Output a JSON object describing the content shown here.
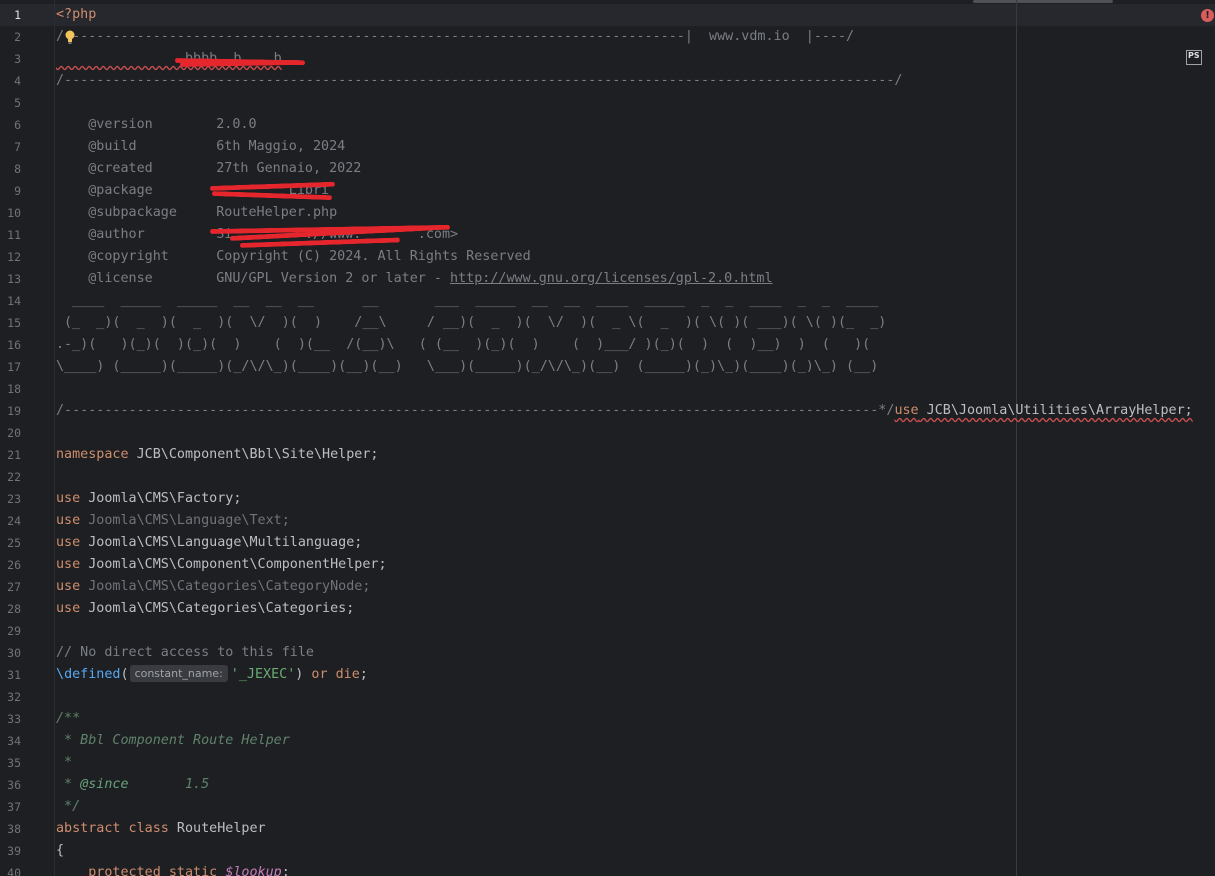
{
  "gutter": {
    "line_numbers": [
      "1",
      "2",
      "3",
      "4",
      "5",
      "6",
      "7",
      "8",
      "9",
      "10",
      "11",
      "12",
      "13",
      "14",
      "15",
      "16",
      "17",
      "18",
      "19",
      "20",
      "21",
      "22",
      "23",
      "24",
      "25",
      "26",
      "27",
      "28",
      "29",
      "30",
      "31",
      "32",
      "33",
      "34",
      "35",
      "36",
      "37",
      "38",
      "39",
      "40"
    ]
  },
  "header": {
    "open_tag": "<?php",
    "banner_top": "/-----------------------------------------------------------------------------|  www.vdm.io  |----/",
    "author_redacted": "                bbbb  b    b",
    "banner_sep": "/-------------------------------------------------------------------------------------------------------/",
    "version_key": "@version",
    "version_val": "2.0.0",
    "build_key": "@build",
    "build_val": "6th Maggio, 2024",
    "created_key": "@created",
    "created_val": "27th Gennaio, 2022",
    "package_key": "@package",
    "package_val": "         Libri",
    "subpackage_key": "@subpackage",
    "subpackage_val": "RouteHelper.php",
    "author_key": "@author",
    "author_val": "Si         ://www.       .com>",
    "copyright_key": "@copyright",
    "copyright_val": "Copyright (C) 2024. All Rights Reserved",
    "license_key": "@license",
    "license_prefix": "GNU/GPL Version 2 or later - ",
    "license_url": "http://www.gnu.org/licenses/gpl-2.0.html",
    "ascii_1": "  ____  _____  _____  __  __  __      __       ___  _____  __  __  ____  _____  _  _  ____  _  _  ____",
    "ascii_2": " (_  _)(  _  )(  _  )(  \\/  )(  )    /__\\     / __)(  _  )(  \\/  )(  _ \\(  _  )( \\( )( ___)( \\( )(_  _)",
    "ascii_3": ".-_)(   )(_)(  )(_)(  )    (  )(__  /(__)\\   ( (__  )(_)(  )    (  )___/ )(_)(  )  (  )__)  )  (   )(",
    "ascii_4": "\\____) (_____)(_____)(_/\\/\\_)(____)(__)(__)   \\___)(_____)(_/\\/\\_)(__)  (_____)(_)\\_)(____)(_)\\_) (__)",
    "banner_end": "/-----------------------------------------------------------------------------------------------------*/",
    "banner_use_kw": "use",
    "banner_use_ns": " JCB\\Joomla\\Utilities\\ArrayHelper;"
  },
  "code": {
    "namespace_kw": "namespace",
    "namespace_val": " JCB\\Component\\Bbl\\Site\\Helper;",
    "use_kw": "use",
    "uses": [
      {
        "ns": " Joomla\\CMS\\Factory;",
        "unused": false
      },
      {
        "ns": " Joomla\\CMS\\Language\\Text;",
        "unused": true
      },
      {
        "ns": " Joomla\\CMS\\Language\\Multilanguage;",
        "unused": false
      },
      {
        "ns": " Joomla\\CMS\\Component\\ComponentHelper;",
        "unused": false
      },
      {
        "ns": " Joomla\\CMS\\Categories\\CategoryNode;",
        "unused": true
      },
      {
        "ns": " Joomla\\CMS\\Categories\\Categories;",
        "unused": false
      }
    ],
    "comment_access": "// No direct access to this file",
    "defined_slash": "\\",
    "defined_fn": "defined",
    "defined_open": "(",
    "param_hint": "constant_name:",
    "defined_arg": "'_JEXEC'",
    "defined_close": ")",
    "or_kw": "or",
    "die_kw": "die",
    "semicolon": ";",
    "doc_open": "/**",
    "doc_title": " * Bbl Component Route Helper",
    "doc_blank": " *",
    "doc_since_star": " * ",
    "doc_since_tag": "@since",
    "doc_since_val": "       1.5",
    "doc_close": " */",
    "abstract_kw": "abstract",
    "class_kw": " class",
    "class_name": " RouteHelper",
    "brace_open": "{",
    "prop_kw": "    protected static",
    "prop_var": "$lookup",
    "prop_end": ";"
  },
  "status": {
    "error_glyph": "!",
    "file_type_badge": "PS"
  },
  "colors": {
    "background": "#1e1f22",
    "keyword": "#cf8e6d",
    "string": "#6aab73",
    "function": "#56a8f5",
    "doc_comment": "#5f826b",
    "error": "#db5c5c"
  }
}
